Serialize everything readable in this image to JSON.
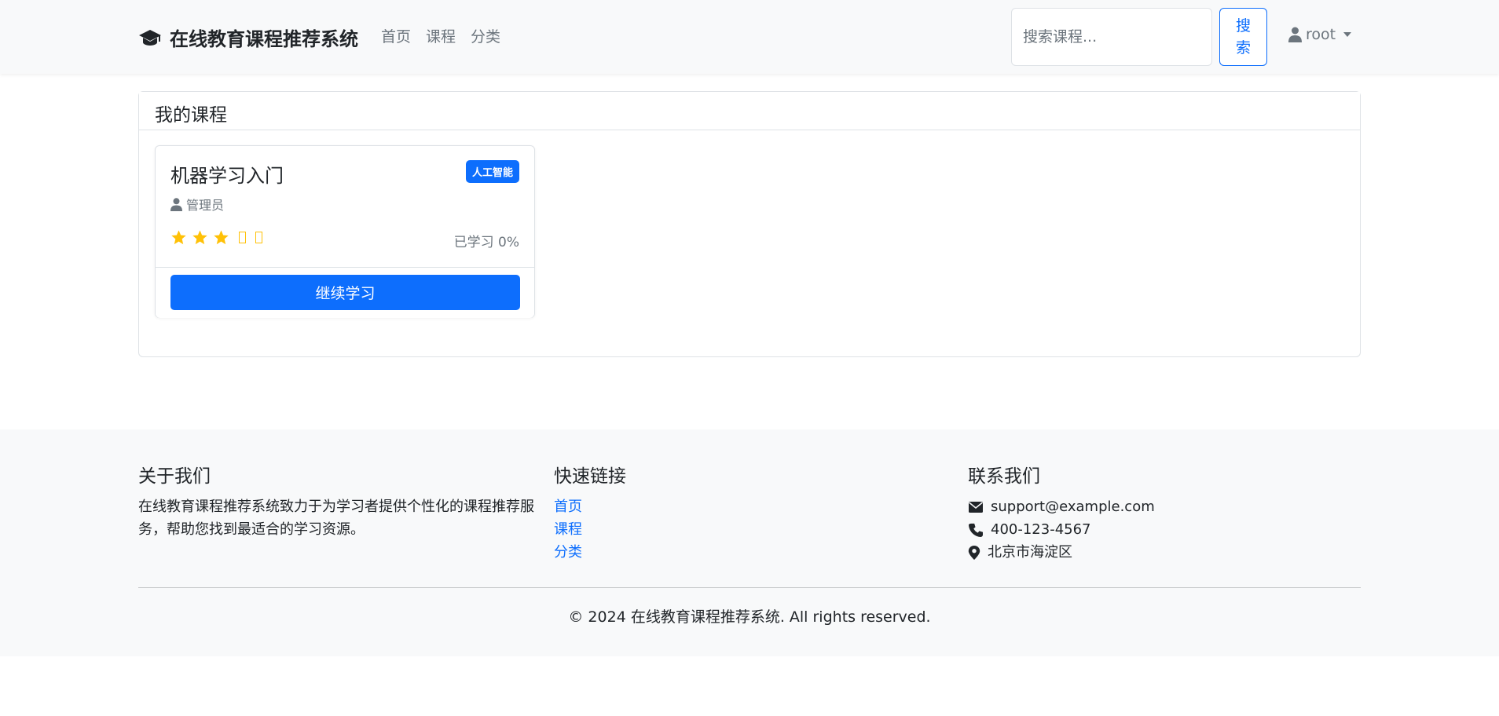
{
  "navbar": {
    "brand": "在线教育课程推荐系统",
    "links": [
      "首页",
      "课程",
      "分类"
    ],
    "search_placeholder": "搜索课程...",
    "search_button": "搜索",
    "user": "root"
  },
  "main": {
    "header": "我的课程",
    "course": {
      "title": "机器学习入门",
      "category_badge": "人工智能",
      "teacher": "管理员",
      "rating": 3,
      "rating_max": 5,
      "progress_text": "已学习 0%",
      "progress_percent": 0,
      "continue_button": "继续学习"
    }
  },
  "footer": {
    "about_title": "关于我们",
    "about_text": "在线教育课程推荐系统致力于为学习者提供个性化的课程推荐服务，帮助您找到最适合的学习资源。",
    "links_title": "快速链接",
    "links": [
      "首页",
      "课程",
      "分类"
    ],
    "contact_title": "联系我们",
    "email": "support@example.com",
    "phone": "400-123-4567",
    "address": "北京市海淀区",
    "copyright": "© 2024 在线教育课程推荐系统. All rights reserved."
  },
  "colors": {
    "primary": "#0d6efd",
    "star": "#ffc107",
    "navbar_bg": "#f8f9fa",
    "muted": "#6c757d"
  },
  "icons": {
    "brand": "graduation-cap-icon",
    "user": "user-icon",
    "teacher": "user-icon",
    "star": "star-icon",
    "email": "envelope-icon",
    "phone": "phone-icon",
    "address": "map-marker-icon"
  }
}
